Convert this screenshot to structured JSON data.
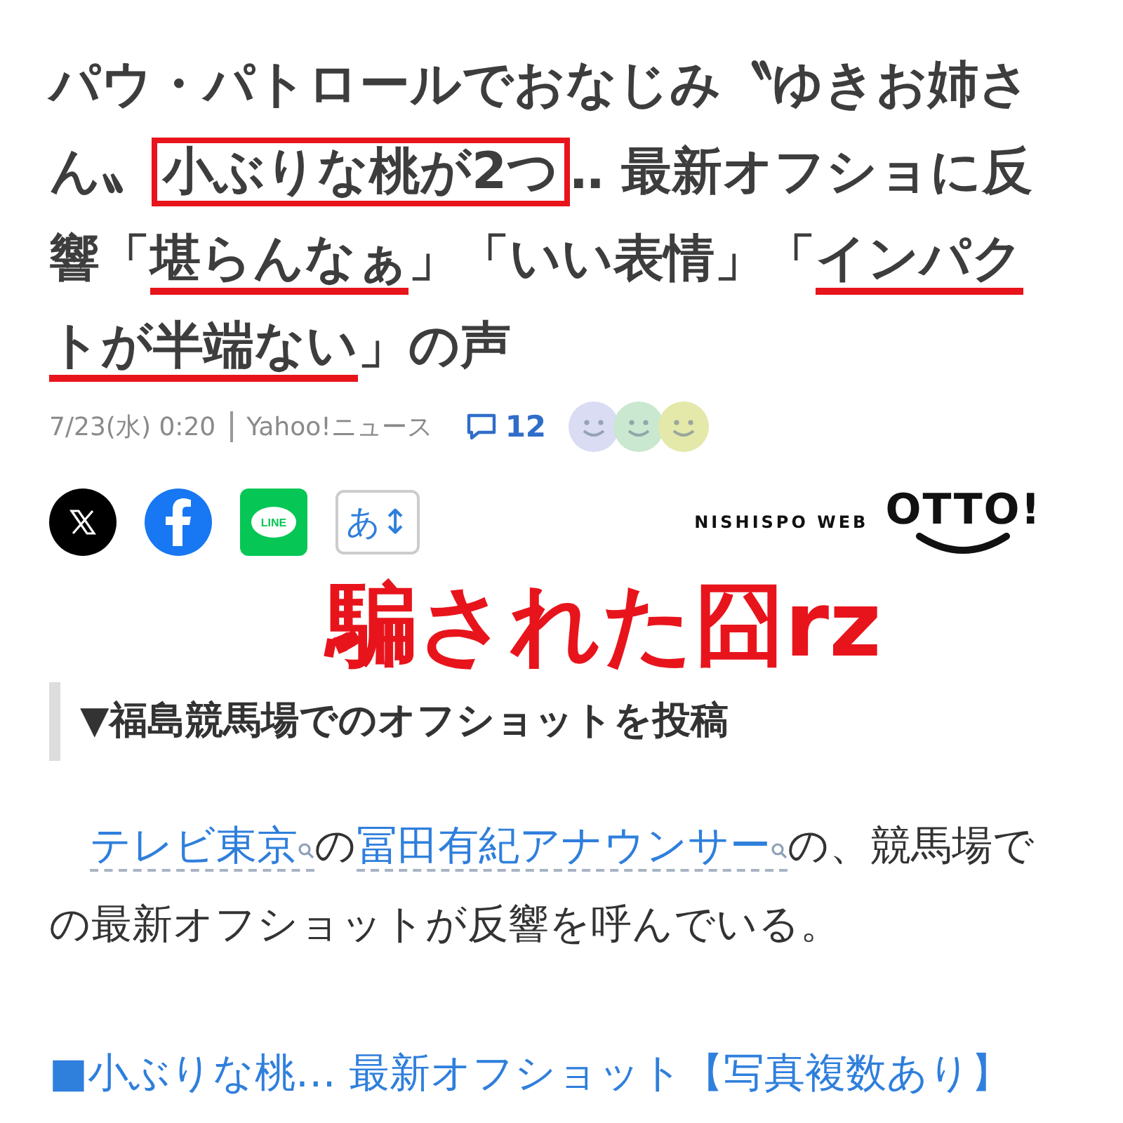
{
  "headline": [
    {
      "kind": "plain",
      "text": "パウ・パトロールでおなじみ〝ゆきお姉さん〟"
    },
    {
      "kind": "boxed",
      "text": "小ぶりな桃が2つ"
    },
    {
      "kind": "plain",
      "text": "‥ 最新オフショに反響「"
    },
    {
      "kind": "underlined",
      "text": "堪らんなぁ"
    },
    {
      "kind": "plain",
      "text": "」「いい表情」「"
    },
    {
      "kind": "underlined",
      "text": "インパクトが半端ない"
    },
    {
      "kind": "plain",
      "text": "」の声"
    }
  ],
  "meta": {
    "date": "7/23(水) 0:20",
    "source": "Yahoo!ニュース",
    "comment_count": "12"
  },
  "reactions": [
    {
      "color": "#d9dcf3"
    },
    {
      "color": "#c9e8cf"
    },
    {
      "color": "#e4e8a9"
    }
  ],
  "share": [
    {
      "kind": "x"
    },
    {
      "kind": "facebook"
    },
    {
      "kind": "line",
      "label": "LINE"
    },
    {
      "kind": "font_size",
      "label": "あ↕"
    }
  ],
  "brand": {
    "prefix": "NISHISPO WEB",
    "name": "OTTO!"
  },
  "caption": "騙された囧rz",
  "section_heading": "▼福島競馬場でのオフショットを投稿",
  "paragraph": [
    {
      "kind": "link",
      "text": "テレビ東京"
    },
    {
      "kind": "text",
      "text": "の"
    },
    {
      "kind": "link",
      "text": "冨田有紀アナウンサー"
    },
    {
      "kind": "text",
      "text": "の、競馬場での最新オフショットが反響を呼んでいる。"
    }
  ],
  "related_link": "■小ぶりな桃… 最新オフショット【写真複数あり】"
}
